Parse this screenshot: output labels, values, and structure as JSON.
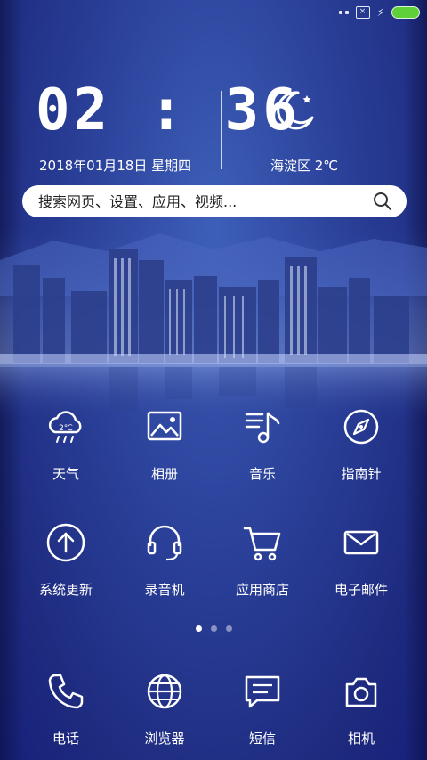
{
  "status": {
    "sim_label": "×",
    "battery_color": "#5fcf3a"
  },
  "clock": {
    "time": "02 : 36",
    "date": "2018年01月18日  星期四"
  },
  "weather": {
    "icon": "moon-star-icon",
    "location_temp": "海淀区 2℃"
  },
  "search": {
    "placeholder": "搜索网页、设置、应用、视频..."
  },
  "apps_row1": [
    {
      "label": "天气",
      "icon": "cloud-rain-icon",
      "icon_text": "2℃"
    },
    {
      "label": "相册",
      "icon": "image-icon"
    },
    {
      "label": "音乐",
      "icon": "music-list-icon"
    },
    {
      "label": "指南针",
      "icon": "compass-icon"
    }
  ],
  "apps_row2": [
    {
      "label": "系统更新",
      "icon": "arrow-up-circle-icon"
    },
    {
      "label": "录音机",
      "icon": "headset-icon"
    },
    {
      "label": "应用商店",
      "icon": "cart-icon"
    },
    {
      "label": "电子邮件",
      "icon": "mail-icon"
    }
  ],
  "dock": [
    {
      "label": "电话",
      "icon": "phone-icon"
    },
    {
      "label": "浏览器",
      "icon": "globe-icon"
    },
    {
      "label": "短信",
      "icon": "message-icon"
    },
    {
      "label": "相机",
      "icon": "camera-icon"
    }
  ],
  "pager": {
    "pages": 3,
    "active": 1
  }
}
